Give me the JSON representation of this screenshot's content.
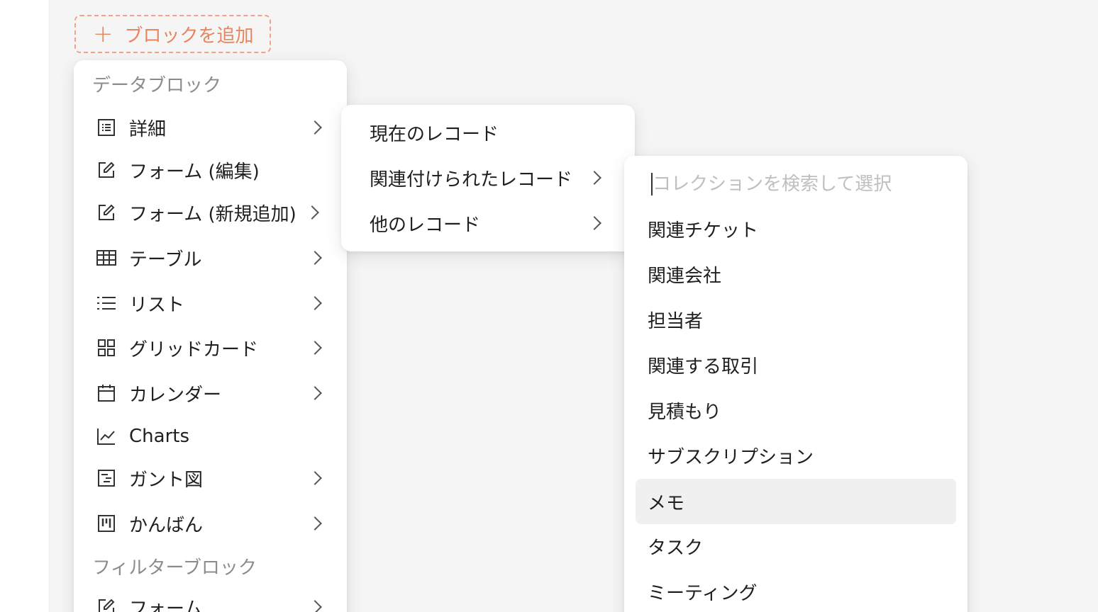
{
  "add_block_button": {
    "label": "ブロックを追加",
    "plus": "+"
  },
  "menu_level1": {
    "group_data_blocks": "データブロック",
    "items": [
      {
        "label": "詳細",
        "icon": "detail-icon",
        "has_submenu": true
      },
      {
        "label": "フォーム (編集)",
        "icon": "form-edit-icon",
        "has_submenu": false
      },
      {
        "label": "フォーム (新規追加)",
        "icon": "form-add-icon",
        "has_submenu": true
      },
      {
        "label": "テーブル",
        "icon": "table-icon",
        "has_submenu": true
      },
      {
        "label": "リスト",
        "icon": "list-icon",
        "has_submenu": true
      },
      {
        "label": "グリッドカード",
        "icon": "grid-card-icon",
        "has_submenu": true
      },
      {
        "label": "カレンダー",
        "icon": "calendar-icon",
        "has_submenu": true
      },
      {
        "label": "Charts",
        "icon": "chart-icon",
        "has_submenu": false
      },
      {
        "label": "ガント図",
        "icon": "gantt-icon",
        "has_submenu": true
      },
      {
        "label": "かんばん",
        "icon": "kanban-icon",
        "has_submenu": true
      }
    ],
    "group_filter_blocks": "フィルターブロック",
    "filter_items": [
      {
        "label": "フォーム",
        "icon": "form-edit-icon",
        "has_submenu": true
      }
    ]
  },
  "menu_level2": {
    "items": [
      {
        "label": "現在のレコード",
        "has_submenu": false
      },
      {
        "label": "関連付けられたレコード",
        "has_submenu": true
      },
      {
        "label": "他のレコード",
        "has_submenu": true
      }
    ]
  },
  "menu_level3": {
    "search_placeholder": "コレクションを検索して選択",
    "items": [
      {
        "label": "関連チケット"
      },
      {
        "label": "関連会社"
      },
      {
        "label": "担当者"
      },
      {
        "label": "関連する取引"
      },
      {
        "label": "見積もり"
      },
      {
        "label": "サブスクリプション"
      },
      {
        "label": "メモ",
        "active": true
      },
      {
        "label": "タスク"
      },
      {
        "label": "ミーティング"
      }
    ]
  },
  "colors": {
    "accent": "#e8845e",
    "accent_border": "#f0a387",
    "background": "#f5f5f5",
    "hover": "#f0f0f0",
    "group_title": "#8c8c8c"
  }
}
